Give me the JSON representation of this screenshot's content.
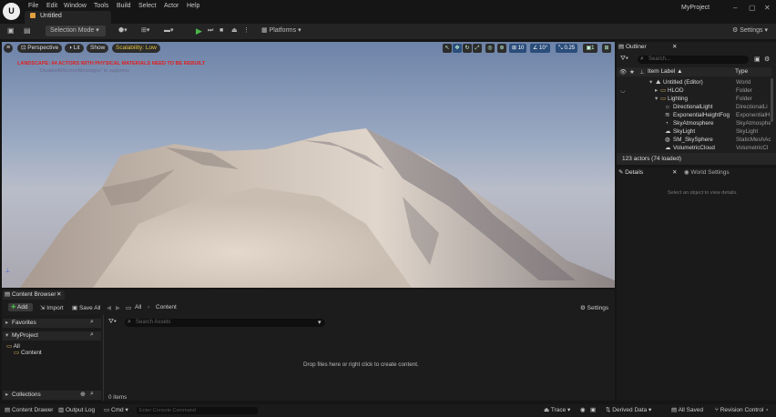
{
  "title_bar": {
    "menus": [
      "File",
      "Edit",
      "Window",
      "Tools",
      "Build",
      "Select",
      "Actor",
      "Help"
    ],
    "doc_tab": "Untitled",
    "project": "MyProject"
  },
  "toolbar": {
    "selection_mode": "Selection Mode",
    "platforms": "Platforms",
    "settings": "Settings"
  },
  "viewport": {
    "perspective": "Perspective",
    "lit": "Lit",
    "show": "Show",
    "scalability": "Scalability: Low",
    "warning": "LANDSCAPE: 64 ACTORS WITH PHYSICAL MATERIALS NEED TO BE REBUILT",
    "warning_sub": "'DisableAllScreenMessages' to suppress",
    "grid_snap": "10",
    "rot_snap": "10°",
    "scale_snap": "0.25",
    "cam_speed": "1"
  },
  "outliner": {
    "tab": "Outliner",
    "search_placeholder": "Search...",
    "col_label": "Item Label ▲",
    "col_type": "Type",
    "rows": [
      {
        "label": "Untitled (Editor)",
        "type": "World"
      },
      {
        "label": "HLOD",
        "type": "Folder"
      },
      {
        "label": "Lighting",
        "type": "Folder"
      },
      {
        "label": "DirectionalLight",
        "type": "DirectionalLi"
      },
      {
        "label": "ExponentialHeightFog",
        "type": "ExponentialH"
      },
      {
        "label": "SkyAtmosphere",
        "type": "SkyAtmosphe"
      },
      {
        "label": "SkyLight",
        "type": "SkyLight"
      },
      {
        "label": "SM_SkySphere",
        "type": "StaticMeshAc"
      },
      {
        "label": "VolumetricCloud",
        "type": "VolumetricCl"
      }
    ],
    "footer": "123 actors (74 loaded)"
  },
  "details": {
    "tab": "Details",
    "tab2": "World Settings",
    "empty": "Select an object to view details."
  },
  "content_browser": {
    "tab": "Content Browser",
    "add": "Add",
    "import": "Import",
    "save_all": "Save All",
    "crumb_all": "All",
    "crumb_content": "Content",
    "settings": "Settings",
    "favorites": "Favorites",
    "project": "MyProject",
    "tree_all": "All",
    "tree_content": "Content",
    "collections": "Collections",
    "search_placeholder": "Search Assets",
    "drop_msg": "Drop files here or right click to create content.",
    "item_count": "0 items"
  },
  "status_bar": {
    "content_drawer": "Content Drawer",
    "output_log": "Output Log",
    "cmd": "Cmd",
    "console_placeholder": "Enter Console Command",
    "trace": "Trace",
    "derived_data": "Derived Data",
    "all_saved": "All Saved",
    "revision_control": "Revision Control"
  }
}
